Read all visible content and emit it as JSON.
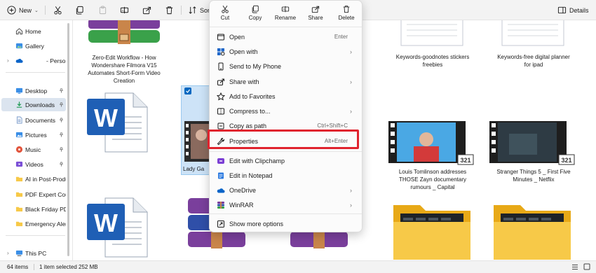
{
  "toolbar": {
    "new_label": "New",
    "sort_label": "Sort",
    "details_label": "Details"
  },
  "sidebar": {
    "items": [
      {
        "label": "Home",
        "icon": "home-icon"
      },
      {
        "label": "Gallery",
        "icon": "gallery-icon"
      },
      {
        "label": "- Person",
        "icon": "onedrive-icon"
      },
      {
        "label": "Desktop",
        "icon": "desktop-icon"
      },
      {
        "label": "Downloads",
        "icon": "downloads-icon"
      },
      {
        "label": "Documents",
        "icon": "documents-icon"
      },
      {
        "label": "Pictures",
        "icon": "pictures-icon"
      },
      {
        "label": "Music",
        "icon": "music-icon"
      },
      {
        "label": "Videos",
        "icon": "videos-icon"
      },
      {
        "label": "AI in Post-Produ",
        "icon": "folder-icon"
      },
      {
        "label": "PDF Expert Coup",
        "icon": "folder-icon"
      },
      {
        "label": "Black Friday PDF",
        "icon": "folder-icon"
      },
      {
        "label": "Emergency Alert",
        "icon": "folder-icon"
      },
      {
        "label": "This PC",
        "icon": "pc-icon"
      }
    ]
  },
  "files": {
    "f1": [
      "Zero-Edit Workflow - How",
      "Wondershare Filmora V15",
      "Automates Short-Form Video",
      "Creation"
    ],
    "f2": [
      "Keywords-goodnotes stickers",
      "freebies"
    ],
    "f3": [
      "Keywords-free digital planner",
      "for ipad"
    ],
    "f4": [
      "Lady Ga"
    ],
    "f5": [
      "Louis Tomlinson addresses",
      "THOSE Zayn documentary",
      "rumours _ Capital"
    ],
    "f6": [
      "Stranger Things 5 _ First Five",
      "Minutes _ Netflix"
    ]
  },
  "context_menu": {
    "quick": [
      "Cut",
      "Copy",
      "Rename",
      "Share",
      "Delete"
    ],
    "items": [
      {
        "label": "Open",
        "shortcut": "Enter",
        "icon": "open-icon"
      },
      {
        "label": "Open with",
        "shortcut": "",
        "icon": "open-with-icon"
      },
      {
        "label": "Send to My Phone",
        "shortcut": "",
        "icon": "phone-icon"
      },
      {
        "label": "Share with",
        "shortcut": "",
        "icon": "share-with-icon"
      },
      {
        "label": "Add to Favorites",
        "shortcut": "",
        "icon": "star-icon"
      },
      {
        "label": "Compress to...",
        "shortcut": "",
        "icon": "compress-icon"
      },
      {
        "label": "Copy as path",
        "shortcut": "Ctrl+Shift+C",
        "icon": "copy-path-icon"
      },
      {
        "label": "Properties",
        "shortcut": "Alt+Enter",
        "icon": "properties-icon"
      },
      {
        "label": "Edit with Clipchamp",
        "shortcut": "",
        "icon": "clipchamp-icon"
      },
      {
        "label": "Edit in Notepad",
        "shortcut": "",
        "icon": "notepad-icon"
      },
      {
        "label": "OneDrive",
        "shortcut": "",
        "icon": "onedrive-icon"
      },
      {
        "label": "WinRAR",
        "shortcut": "",
        "icon": "winrar-icon"
      },
      {
        "label": "Show more options",
        "shortcut": "",
        "icon": "more-options-icon"
      }
    ]
  },
  "status": {
    "items_count": "64 items",
    "selection": "1 item selected  252 MB"
  },
  "colors": {
    "accent": "#0067c0",
    "highlight": "#e0232e",
    "selection": "#cde3f7"
  }
}
